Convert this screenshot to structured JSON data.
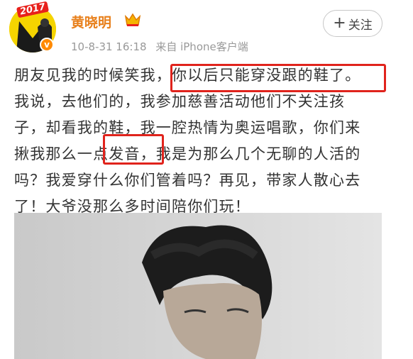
{
  "profile": {
    "avatar_badge": "2017",
    "vip_mark": "v",
    "username": "黄晓明",
    "timestamp": "10-8-31 16:18",
    "source": "来自 iPhone客户端"
  },
  "follow_button": {
    "plus": "+",
    "label": "关注"
  },
  "post": {
    "lines": [
      {
        "before": "朋友见我的时候笑我，",
        "highlight": "你以后只能穿没跟的鞋了。",
        "after": ""
      },
      {
        "text": "我说，去他们的，我参加慈善活动他们不关注孩"
      },
      {
        "text": "子，却看我的鞋，我一腔热情为奥运唱歌，你们来"
      },
      {
        "before": "揪我那么一点",
        "highlight": "发音",
        "after": "，我是为那么几个无聊的人活的"
      },
      {
        "text": "吗？我爱穿什么你们管着吗？再见，带家人散心去"
      },
      {
        "text": "了！大爷没那么多时间陪你们玩！"
      }
    ]
  },
  "colors": {
    "username": "#e8801c",
    "highlight_box": "#e0231c",
    "meta_text": "#999999"
  }
}
